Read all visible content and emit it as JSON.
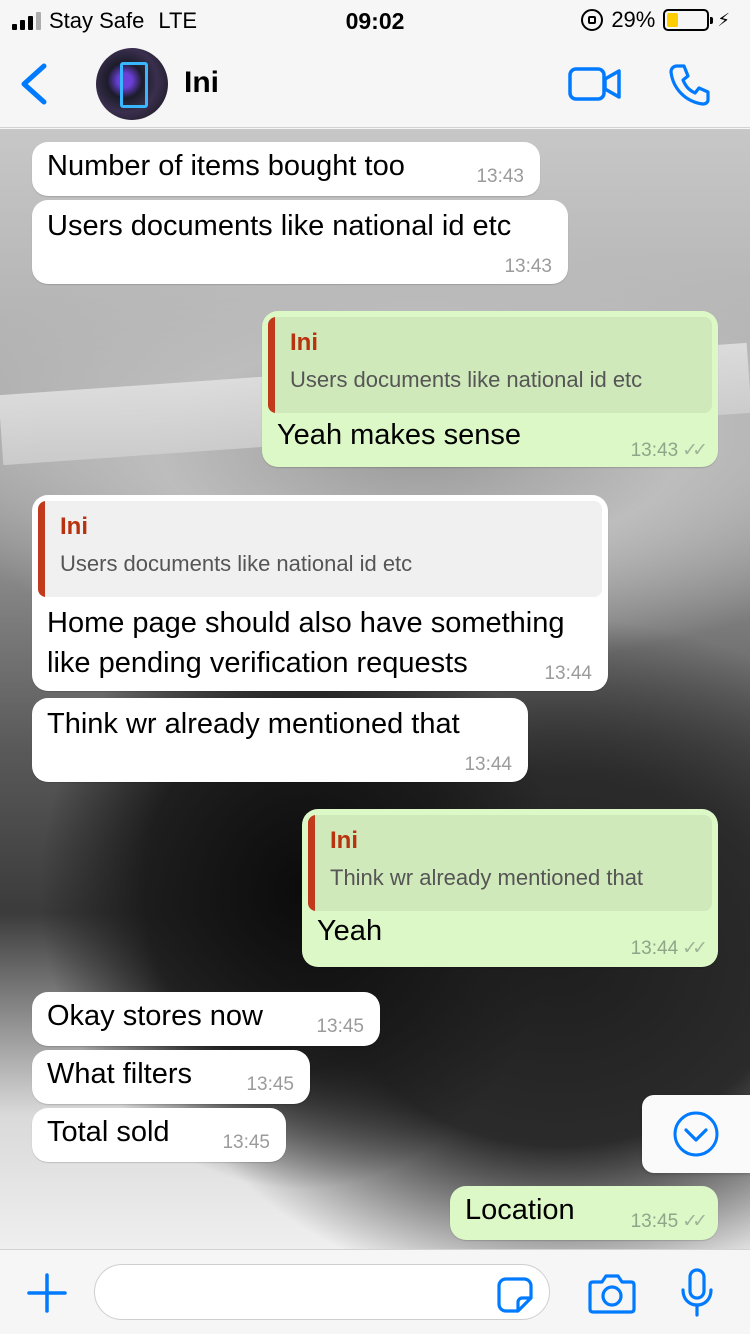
{
  "status_bar": {
    "carrier": "Stay Safe",
    "network": "LTE",
    "time": "09:02",
    "battery_percent": "29%",
    "battery_level": 0.29,
    "battery_color": "#ffcc00"
  },
  "header": {
    "contact_name": "Ini",
    "back_icon": "chevron-left-icon",
    "video_icon": "video-camera-icon",
    "call_icon": "phone-icon",
    "accent_color": "#007aff"
  },
  "messages": [
    {
      "direction": "in",
      "text": "Number of items bought too",
      "time": "13:43"
    },
    {
      "direction": "in",
      "text": "Users documents like national id etc",
      "time": "13:43"
    },
    {
      "direction": "out",
      "quote_author": "Ini",
      "quote_text": "Users documents like national id etc",
      "text": "Yeah makes sense",
      "time": "13:43"
    },
    {
      "direction": "in",
      "quote_author": "Ini",
      "quote_text": "Users documents like national id etc",
      "text_line1": "Home page should also have something",
      "text_line2": "like pending verification requests",
      "time": "13:44"
    },
    {
      "direction": "in",
      "text": "Think wr already mentioned that",
      "time": "13:44"
    },
    {
      "direction": "out",
      "quote_author": "Ini",
      "quote_text": "Think wr already mentioned that",
      "text": "Yeah",
      "time": "13:44"
    },
    {
      "direction": "in",
      "text": "Okay stores now",
      "time": "13:45"
    },
    {
      "direction": "in",
      "text": "What filters",
      "time": "13:45"
    },
    {
      "direction": "in",
      "text": "Total sold",
      "time": "13:45"
    },
    {
      "direction": "out",
      "text": "Location",
      "time": "13:45"
    }
  ],
  "input_bar": {
    "placeholder": "",
    "plus_icon": "plus-icon",
    "sticker_icon": "sticker-icon",
    "camera_icon": "camera-icon",
    "mic_icon": "microphone-icon"
  },
  "colors": {
    "incoming_bubble": "#ffffff",
    "outgoing_bubble": "#dcf8c6",
    "quote_author": "#b8320f"
  }
}
